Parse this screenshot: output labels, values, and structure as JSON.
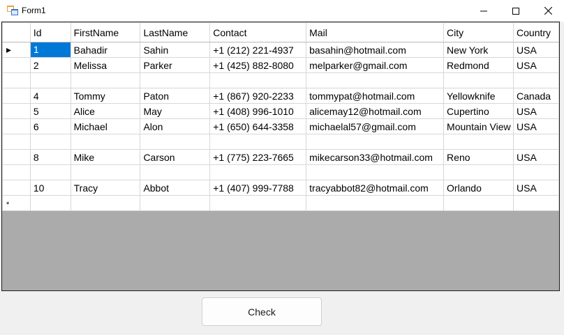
{
  "window": {
    "title": "Form1"
  },
  "grid": {
    "columns": [
      "Id",
      "FirstName",
      "LastName",
      "Contact",
      "Mail",
      "City",
      "Country"
    ],
    "rows": [
      [
        "1",
        "Bahadir",
        "Sahin",
        "+1 (212) 221-4937",
        "basahin@hotmail.com",
        "New York",
        "USA"
      ],
      [
        "2",
        "Melissa",
        "Parker",
        "+1 (425) 882-8080",
        "melparker@gmail.com",
        "Redmond",
        "USA"
      ],
      [
        "",
        "",
        "",
        "",
        "",
        "",
        ""
      ],
      [
        "4",
        "Tommy",
        "Paton",
        "+1 (867) 920-2233",
        "tommypat@hotmail.com",
        "Yellowknife",
        "Canada"
      ],
      [
        "5",
        "Alice",
        "May",
        "+1 (408) 996-1010",
        "alicemay12@hotmail.com",
        "Cupertino",
        "USA"
      ],
      [
        "6",
        "Michael",
        "Alon",
        "+1 (650) 644-3358",
        "michaelal57@gmail.com",
        "Mountain View",
        "USA"
      ],
      [
        "",
        "",
        "",
        "",
        "",
        "",
        ""
      ],
      [
        "8",
        "Mike",
        "Carson",
        "+1 (775) 223-7665",
        "mikecarson33@hotmail.com",
        "Reno",
        "USA"
      ],
      [
        "",
        "",
        "",
        "",
        "",
        "",
        ""
      ],
      [
        "10",
        "Tracy",
        "Abbot",
        "+1 (407) 999-7788",
        "tracyabbot82@hotmail.com",
        "Orlando",
        "USA"
      ]
    ],
    "current_row_marker": "▸",
    "new_row_marker": "*"
  },
  "buttons": {
    "check_label": "Check"
  },
  "colors": {
    "selection": "#0078d7",
    "grid_background": "#ababab"
  }
}
